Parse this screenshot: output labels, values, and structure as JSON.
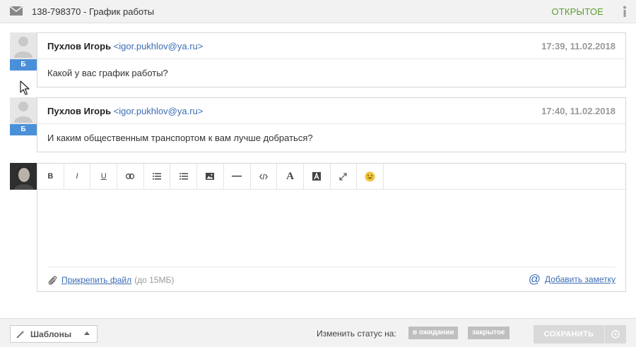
{
  "header": {
    "ticket_title": "138-798370 - График работы",
    "status": "ОТКРЫТОЕ"
  },
  "messages": [
    {
      "author": "Пухлов Игорь",
      "email": "<igor.pukhlov@ya.ru>",
      "time": "17:39, 11.02.2018",
      "badge": "Б",
      "text": "Какой у вас график работы?"
    },
    {
      "author": "Пухлов Игорь",
      "email": "<igor.pukhlov@ya.ru>",
      "time": "17:40, 11.02.2018",
      "badge": "Б",
      "text": "И каким общественным транспортом к вам лучше добраться?"
    }
  ],
  "editor": {
    "toolbar": {
      "bold": "B",
      "italic": "I",
      "underline": "U",
      "heading": "A"
    },
    "attach_label": "Прикрепить файл",
    "attach_limit": "(до 15МБ)",
    "note_label": "Добавить заметку"
  },
  "footer": {
    "templates_label": "Шаблоны",
    "status_change_label": "Изменить статус на:",
    "status_options": [
      "в ожидании",
      "закрытое"
    ],
    "save_label": "СОХРАНИТЬ"
  },
  "colors": {
    "accent_blue": "#4a90d9",
    "link_blue": "#3b6db3",
    "status_green": "#5a9e2f"
  }
}
